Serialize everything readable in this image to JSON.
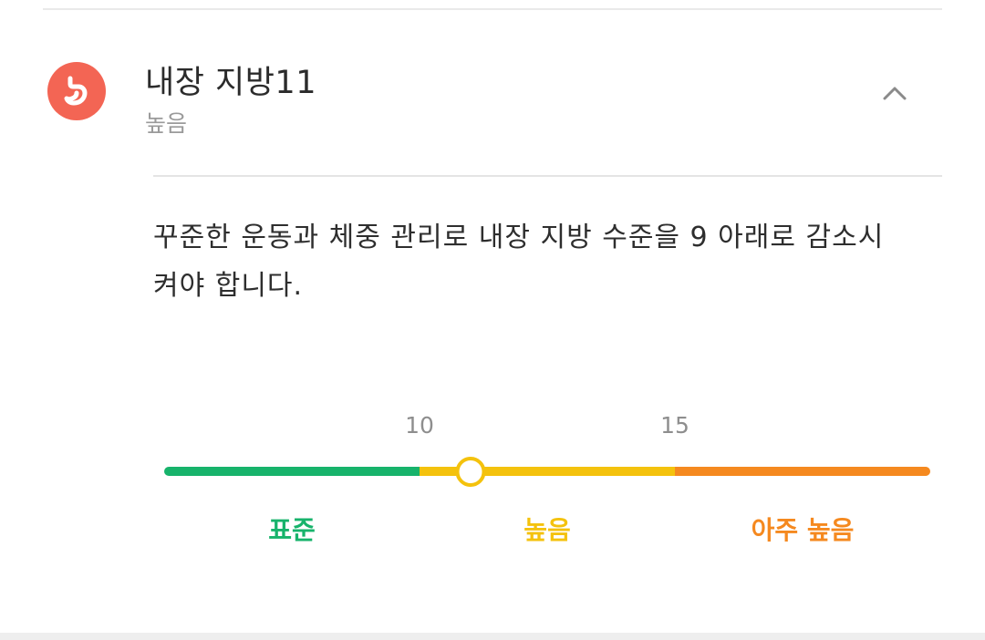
{
  "card": {
    "title": "내장 지방11",
    "status": "높음",
    "icon": "stomach-icon",
    "accent": "#f36554"
  },
  "advice": "꾸준한 운동과 체중 관리로 내장 지방 수준을 9 아래로 감소시켜야 합니다.",
  "scale": {
    "value": 11,
    "min": 5,
    "max": 20,
    "thresholds": [
      {
        "label": "10",
        "value": 10
      },
      {
        "label": "15",
        "value": 15
      }
    ],
    "ranges": [
      {
        "label": "표준",
        "from": 5,
        "to": 10,
        "color": "#17b36b"
      },
      {
        "label": "높음",
        "from": 10,
        "to": 15,
        "color": "#f4c20d"
      },
      {
        "label": "아주 높음",
        "from": 15,
        "to": 20,
        "color": "#f5891f"
      }
    ]
  }
}
